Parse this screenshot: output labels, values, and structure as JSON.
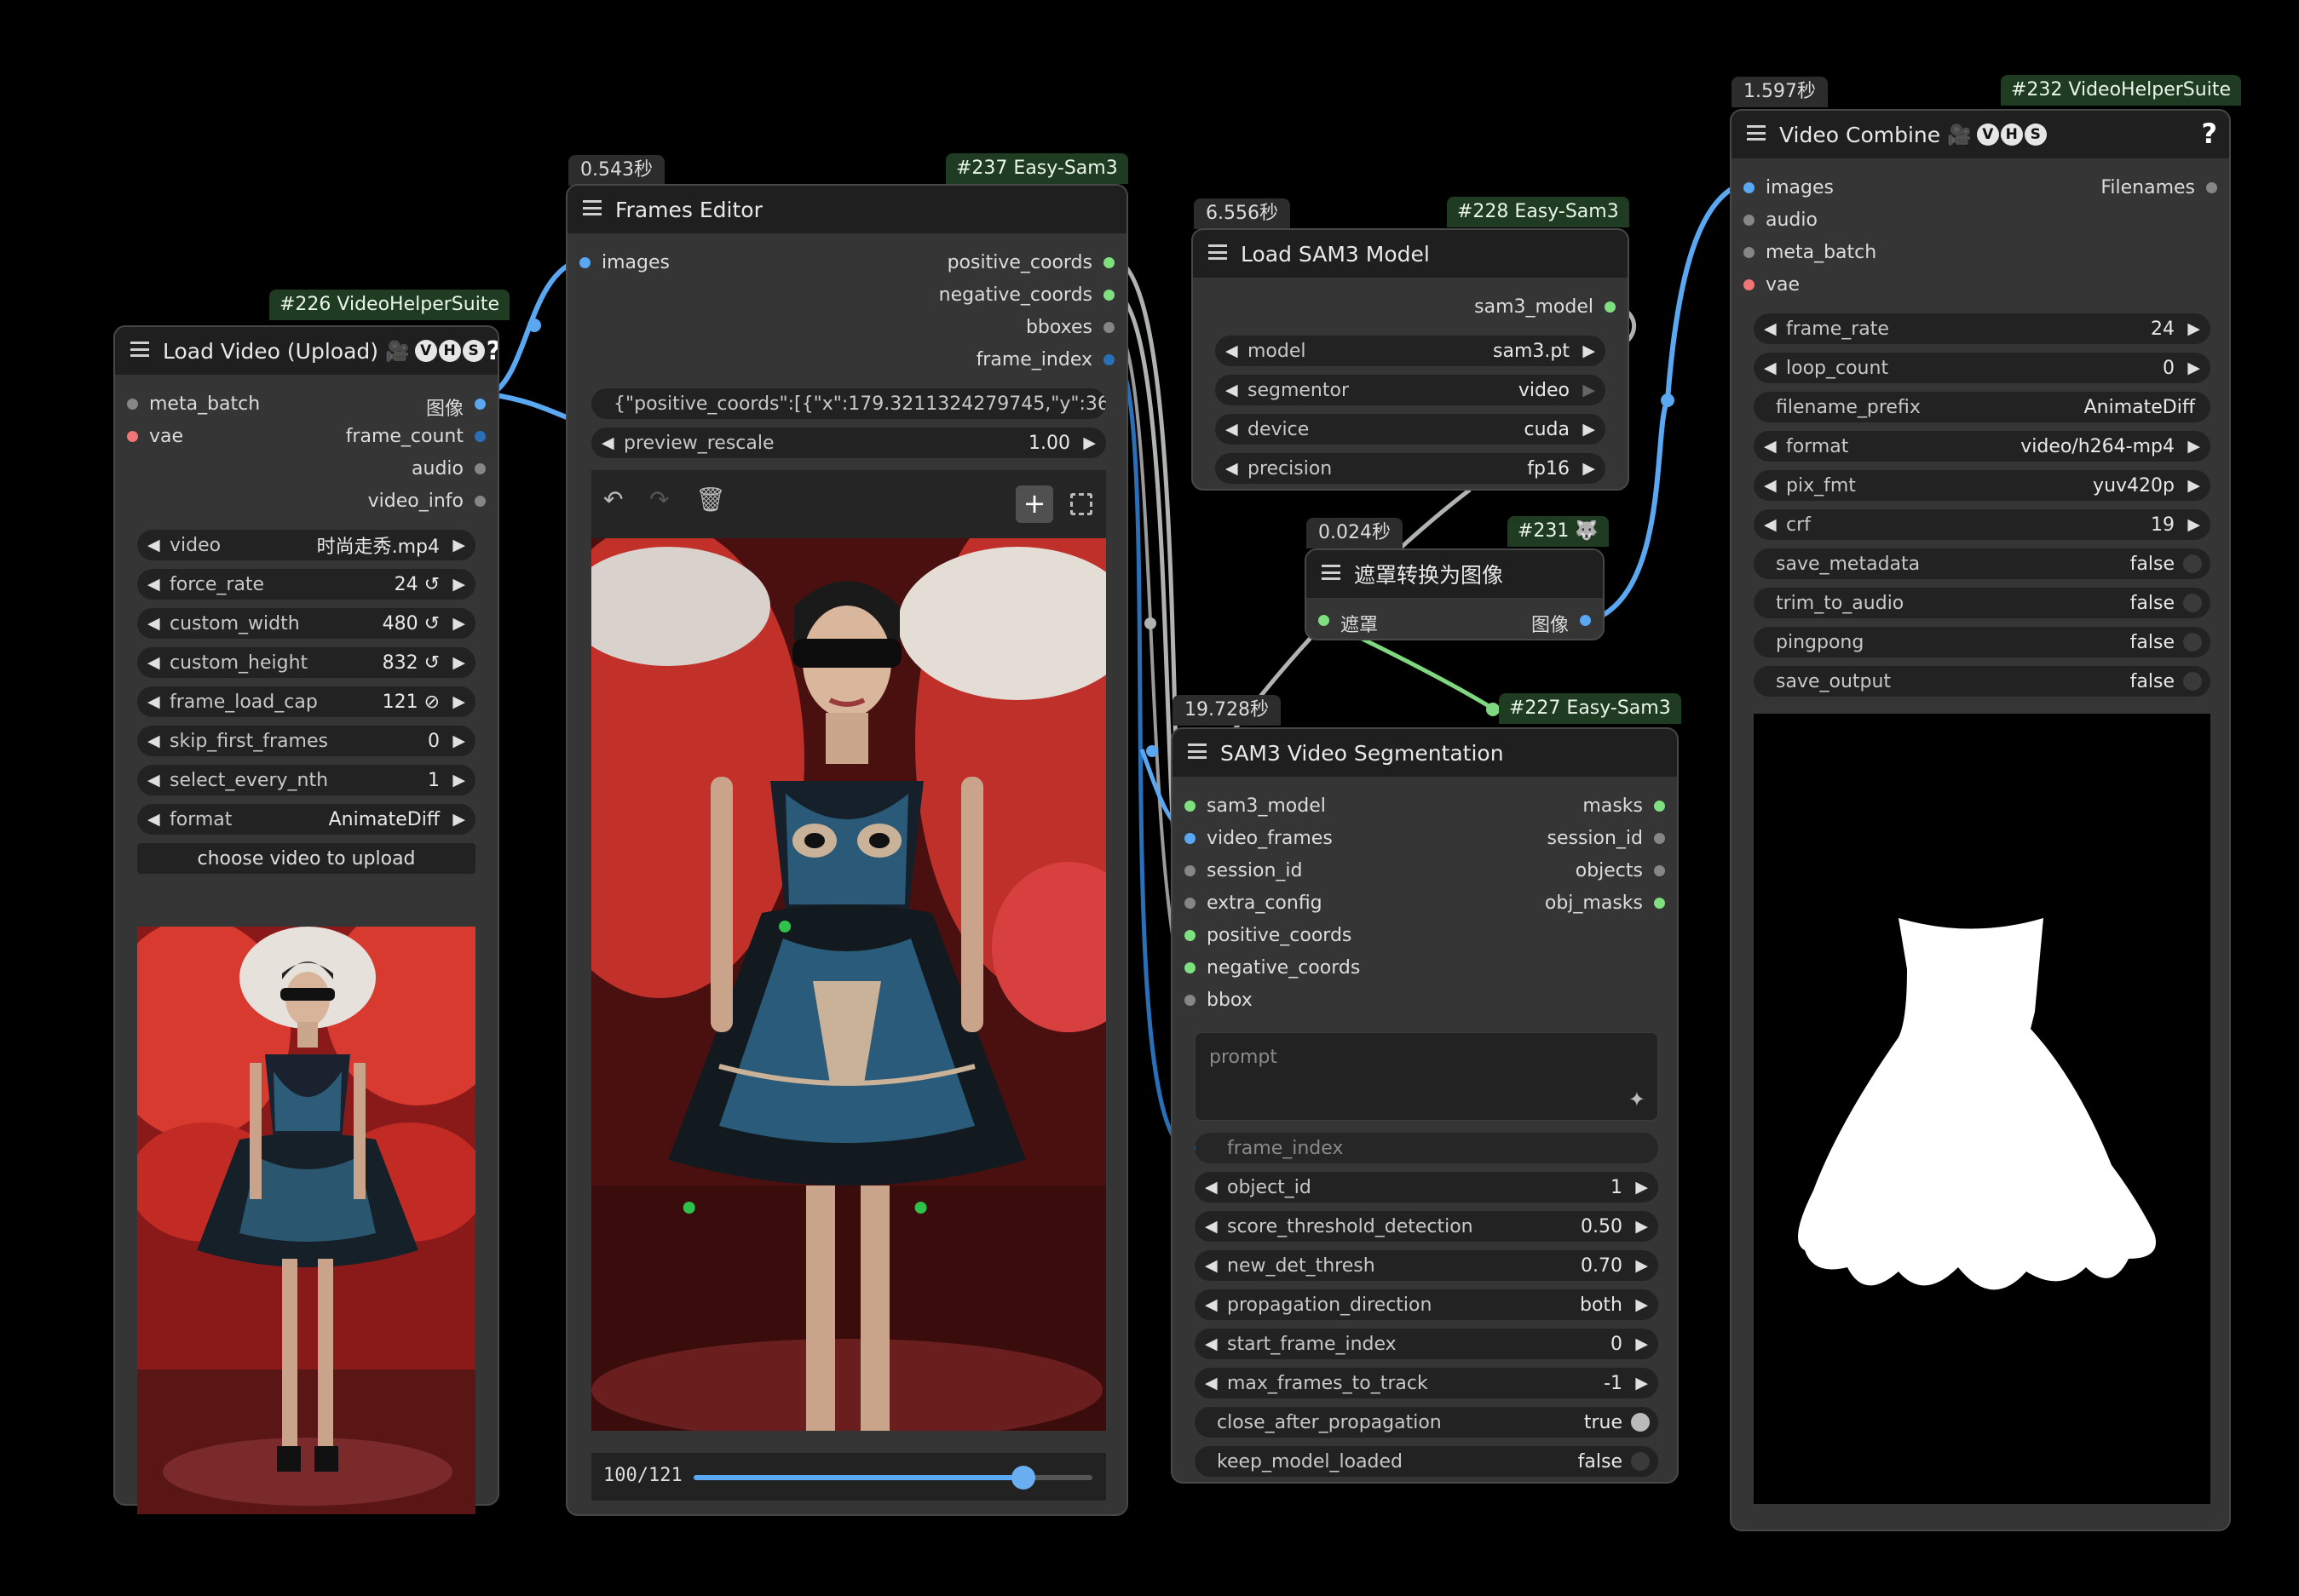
{
  "colors": {
    "canvas": "#000000",
    "node_body": "#353535",
    "node_title": "#1f1f1f",
    "widget": "#222222",
    "badge_green": "#1f3b21",
    "wire_blue": "#5aa7f2",
    "wire_gray": "#b0b4b0",
    "wire_green": "#7fd77f"
  },
  "load_video": {
    "id": "#226 VideoHelperSuite",
    "title": "Load Video (Upload)",
    "badges": [
      "V",
      "H",
      "S"
    ],
    "help": "?",
    "inputs": [
      {
        "name": "meta_batch",
        "color": "gray"
      },
      {
        "name": "vae",
        "color": "red"
      }
    ],
    "outputs": [
      {
        "name": "图像",
        "color": "blue"
      },
      {
        "name": "frame_count",
        "color": "dblue"
      },
      {
        "name": "audio",
        "color": "gray"
      },
      {
        "name": "video_info",
        "color": "gray"
      }
    ],
    "widgets": [
      {
        "label": "video",
        "value": "时尚走秀.mp4"
      },
      {
        "label": "force_rate",
        "value": "24 ↺"
      },
      {
        "label": "custom_width",
        "value": "480 ↺"
      },
      {
        "label": "custom_height",
        "value": "832 ↺"
      },
      {
        "label": "frame_load_cap",
        "value": "121 ⊘"
      },
      {
        "label": "skip_first_frames",
        "value": "0"
      },
      {
        "label": "select_every_nth",
        "value": "1"
      },
      {
        "label": "format",
        "value": "AnimateDiff"
      }
    ],
    "upload_button": "choose video to upload"
  },
  "frames_editor": {
    "timing": "0.543秒",
    "id": "#237 Easy-Sam3",
    "title": "Frames Editor",
    "inputs": [
      {
        "name": "images",
        "color": "blue"
      }
    ],
    "outputs": [
      {
        "name": "positive_coords",
        "color": "green"
      },
      {
        "name": "negative_coords",
        "color": "green"
      },
      {
        "name": "bboxes",
        "color": "gray"
      },
      {
        "name": "frame_index",
        "color": "dblue"
      }
    ],
    "coords_text": "{\"positive_coords\":[{\"x\":179.3211324279745,\"y\":365 ...",
    "preview_rescale": {
      "label": "preview_rescale",
      "value": "1.00"
    },
    "frame_counter": "100/121",
    "frame_current": 100,
    "frame_total": 121,
    "points": [
      {
        "x": 0.376,
        "y": 0.435,
        "type": "positive"
      },
      {
        "x": 0.19,
        "y": 0.75,
        "type": "positive"
      },
      {
        "x": 0.64,
        "y": 0.75,
        "type": "positive"
      }
    ]
  },
  "load_sam3": {
    "timing": "6.556秒",
    "id": "#228 Easy-Sam3",
    "title": "Load SAM3 Model",
    "outputs": [
      {
        "name": "sam3_model",
        "color": "green"
      }
    ],
    "widgets": [
      {
        "label": "model",
        "value": "sam3.pt"
      },
      {
        "label": "segmentor",
        "value": "video"
      },
      {
        "label": "device",
        "value": "cuda"
      },
      {
        "label": "precision",
        "value": "fp16"
      }
    ]
  },
  "mask_to_image": {
    "timing": "0.024秒",
    "id": "#231 🐺",
    "title": "遮罩转换为图像",
    "inputs": [
      {
        "name": "遮罩",
        "color": "green"
      }
    ],
    "outputs": [
      {
        "name": "图像",
        "color": "blue"
      }
    ]
  },
  "sam3_seg": {
    "timing": "19.728秒",
    "id": "#227 Easy-Sam3",
    "title": "SAM3 Video Segmentation",
    "inputs": [
      {
        "name": "sam3_model",
        "color": "green"
      },
      {
        "name": "video_frames",
        "color": "blue"
      },
      {
        "name": "session_id",
        "color": "gray"
      },
      {
        "name": "extra_config",
        "color": "gray"
      },
      {
        "name": "positive_coords",
        "color": "green"
      },
      {
        "name": "negative_coords",
        "color": "green"
      },
      {
        "name": "bbox",
        "color": "gray"
      }
    ],
    "outputs": [
      {
        "name": "masks",
        "color": "green"
      },
      {
        "name": "session_id",
        "color": "gray"
      },
      {
        "name": "objects",
        "color": "gray"
      },
      {
        "name": "obj_masks",
        "color": "green"
      }
    ],
    "prompt_placeholder": "prompt",
    "frame_index_label": "frame_index",
    "widgets": [
      {
        "label": "object_id",
        "value": "1"
      },
      {
        "label": "score_threshold_detection",
        "value": "0.50"
      },
      {
        "label": "new_det_thresh",
        "value": "0.70"
      },
      {
        "label": "propagation_direction",
        "value": "both"
      },
      {
        "label": "start_frame_index",
        "value": "0"
      },
      {
        "label": "max_frames_to_track",
        "value": "-1"
      }
    ],
    "toggles": [
      {
        "label": "close_after_propagation",
        "value": "true"
      },
      {
        "label": "keep_model_loaded",
        "value": "false"
      }
    ]
  },
  "video_combine": {
    "timing": "1.597秒",
    "id": "#232 VideoHelperSuite",
    "title": "Video Combine",
    "badges": [
      "V",
      "H",
      "S"
    ],
    "help": "?",
    "inputs": [
      {
        "name": "images",
        "color": "blue"
      },
      {
        "name": "audio",
        "color": "gray"
      },
      {
        "name": "meta_batch",
        "color": "gray"
      },
      {
        "name": "vae",
        "color": "red"
      }
    ],
    "outputs": [
      {
        "name": "Filenames",
        "color": "gray"
      }
    ],
    "widgets": [
      {
        "label": "frame_rate",
        "value": "24"
      },
      {
        "label": "loop_count",
        "value": "0"
      },
      {
        "label": "filename_prefix",
        "value": "AnimateDiff"
      },
      {
        "label": "format",
        "value": "video/h264-mp4"
      },
      {
        "label": "pix_fmt",
        "value": "yuv420p"
      },
      {
        "label": "crf",
        "value": "19"
      }
    ],
    "toggles": [
      {
        "label": "save_metadata",
        "value": "false"
      },
      {
        "label": "trim_to_audio",
        "value": "false"
      },
      {
        "label": "pingpong",
        "value": "false"
      },
      {
        "label": "save_output",
        "value": "false"
      }
    ]
  }
}
